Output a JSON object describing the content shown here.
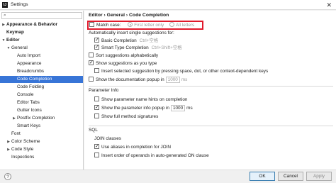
{
  "window": {
    "title": "Settings",
    "app_icon_text": "IJ",
    "close_glyph": "✕"
  },
  "sidebar": {
    "search_glyph": "⌕",
    "items": [
      {
        "label": "Appearance & Behavior",
        "arrow": "▶",
        "bold": true
      },
      {
        "label": "Keymap",
        "arrow": "",
        "bold": true
      },
      {
        "label": "Editor",
        "arrow": "▼",
        "bold": false
      },
      {
        "label": "General",
        "arrow": "▼",
        "bold": false
      },
      {
        "label": "Auto Import",
        "arrow": "",
        "bold": false
      },
      {
        "label": "Appearance",
        "arrow": "",
        "bold": false
      },
      {
        "label": "Breadcrumbs",
        "arrow": "",
        "bold": false
      },
      {
        "label": "Code Completion",
        "arrow": "",
        "bold": false,
        "selected": true
      },
      {
        "label": "Code Folding",
        "arrow": "",
        "bold": false
      },
      {
        "label": "Console",
        "arrow": "",
        "bold": false
      },
      {
        "label": "Editor Tabs",
        "arrow": "",
        "bold": false
      },
      {
        "label": "Gutter Icons",
        "arrow": "",
        "bold": false
      },
      {
        "label": "Postfix Completion",
        "arrow": "▶",
        "bold": false
      },
      {
        "label": "Smart Keys",
        "arrow": "",
        "bold": false
      },
      {
        "label": "Font",
        "arrow": "",
        "bold": false
      },
      {
        "label": "Color Scheme",
        "arrow": "▶",
        "bold": false
      },
      {
        "label": "Code Style",
        "arrow": "▶",
        "bold": false
      },
      {
        "label": "Inspections",
        "arrow": "",
        "bold": false
      }
    ]
  },
  "content": {
    "breadcrumb": "Editor  ›  General  ›  Code Completion",
    "match_case": {
      "label": "Match case:",
      "checked": false
    },
    "radio_first_letter": "First letter only",
    "radio_all_letters": "All letters",
    "auto_insert_label": "Automatically insert single suggestions for:",
    "basic_completion": {
      "label": "Basic Completion",
      "shortcut": "Ctrl+空格",
      "checked": true
    },
    "smart_type_completion": {
      "label": "Smart Type Completion",
      "shortcut": "Ctrl+Shift+空格",
      "checked": true
    },
    "sort_alpha": {
      "label": "Sort suggestions alphabetically",
      "checked": false
    },
    "show_as_you_type": {
      "label": "Show suggestions as you type",
      "checked": true
    },
    "insert_selected": {
      "label": "Insert selected suggestion by pressing space, dot, or other context-dependent keys",
      "checked": false
    },
    "show_doc_popup": {
      "label": "Show the documentation popup in",
      "value": "1000",
      "unit": "ms",
      "checked": false
    },
    "param_info_label": "Parameter Info",
    "show_param_hints": {
      "label": "Show parameter name hints on completion",
      "checked": false
    },
    "show_param_popup": {
      "label": "Show the parameter info popup in",
      "value": "1000",
      "unit": "ms",
      "checked": true
    },
    "show_full_signatures": {
      "label": "Show full method signatures",
      "checked": false
    },
    "sql_label": "SQL",
    "join_label": "JOIN clauses",
    "use_aliases": {
      "label": "Use aliases in completion for JOIN",
      "checked": true
    },
    "insert_order": {
      "label": "Insert order of operands in auto-generated ON clause",
      "checked": false
    }
  },
  "footer": {
    "help_glyph": "?",
    "ok_label": "OK",
    "cancel_label": "Cancel",
    "apply_label": "Apply"
  },
  "colors": {
    "selection": "#3875d7",
    "highlight_box": "#e0192b"
  }
}
